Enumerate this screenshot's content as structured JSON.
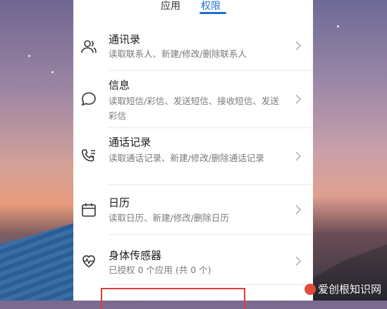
{
  "tabs": {
    "app": "应用",
    "permissions": "权限"
  },
  "items": [
    {
      "title": "通讯录",
      "desc": "读取联系人、新建/修改/删除联系人",
      "icon": "contacts-icon"
    },
    {
      "title": "信息",
      "desc": "读取短信/彩信、发送短信、接收短信、发送彩信",
      "icon": "message-icon"
    },
    {
      "title": "通话记录",
      "desc": "读取通话记录、新建/修改/删除通话记录",
      "icon": "call-log-icon"
    },
    {
      "title": "日历",
      "desc": "读取日历、新建/修改/删除日历",
      "icon": "calendar-icon"
    },
    {
      "title": "身体传感器",
      "desc": "已授权 0 个应用 (共 0 个)",
      "icon": "heart-rate-icon"
    }
  ],
  "watermark": "爱创根知识网",
  "colors": {
    "accent": "#1f6fcf",
    "highlight_box": "#e23b3b"
  }
}
